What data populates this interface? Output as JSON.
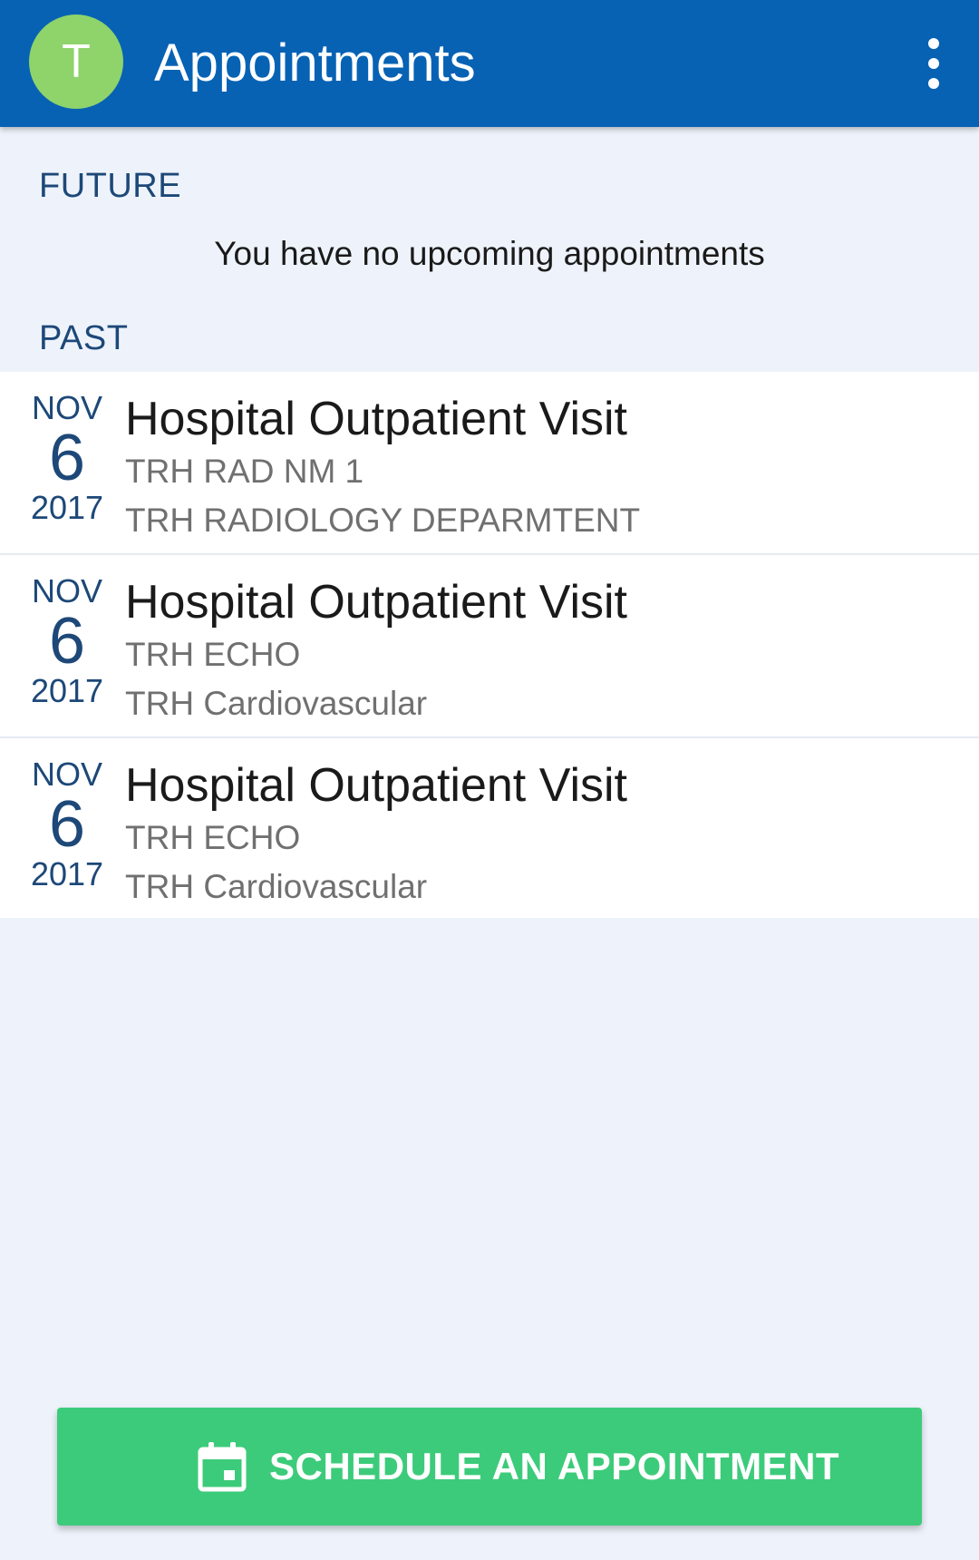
{
  "header": {
    "avatar_initial": "T",
    "title": "Appointments",
    "menu_icon": "more-vert-icon"
  },
  "future": {
    "label": "FUTURE",
    "empty_message": "You have no upcoming appointments"
  },
  "past": {
    "label": "PAST",
    "appointments": [
      {
        "month": "NOV",
        "day": "6",
        "year": "2017",
        "title": "Hospital Outpatient Visit",
        "line1": "TRH RAD NM 1",
        "line2": "TRH RADIOLOGY DEPARMTENT"
      },
      {
        "month": "NOV",
        "day": "6",
        "year": "2017",
        "title": "Hospital Outpatient Visit",
        "line1": "TRH ECHO",
        "line2": "TRH Cardiovascular"
      },
      {
        "month": "NOV",
        "day": "6",
        "year": "2017",
        "title": "Hospital Outpatient Visit",
        "line1": "TRH ECHO",
        "line2": "TRH Cardiovascular"
      }
    ]
  },
  "schedule_button": {
    "label": "SCHEDULE AN APPOINTMENT",
    "icon": "calendar-icon"
  },
  "colors": {
    "app_bar": "#0762b4",
    "avatar": "#8fd36b",
    "background": "#eef3fb",
    "accent_text": "#1d4878",
    "schedule_button": "#3ccb7a"
  }
}
